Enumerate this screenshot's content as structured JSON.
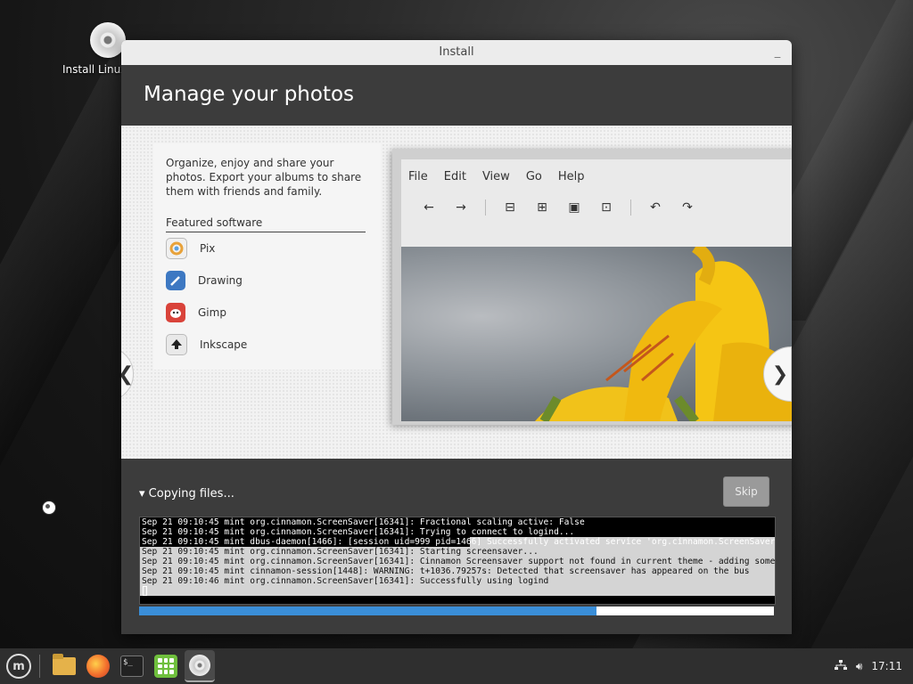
{
  "desktop": {
    "icon_label": "Install Linux"
  },
  "window": {
    "title": "Install",
    "minimize_glyph": "_",
    "heading": "Manage your photos",
    "description": "Organize, enjoy and share your photos. Export your albums to share them with friends and family.",
    "featured_title": "Featured software",
    "apps": [
      {
        "name": "Pix",
        "icon": "pix-icon",
        "color": "#f0f0f0"
      },
      {
        "name": "Drawing",
        "icon": "drawing-icon",
        "color": "#3d78c2"
      },
      {
        "name": "Gimp",
        "icon": "gimp-icon",
        "color": "#d9433a"
      },
      {
        "name": "Inkscape",
        "icon": "inkscape-icon",
        "color": "#e9e9e9"
      }
    ],
    "screenshot_menu": [
      "File",
      "Edit",
      "View",
      "Go",
      "Help"
    ],
    "prev_glyph": "❮",
    "next_glyph": "❯",
    "status": "▾ Copying files...",
    "skip_label": "Skip",
    "log_lines": [
      "Sep 21 09:10:45 mint org.cinnamon.ScreenSaver[16341]: Fractional scaling active: False",
      "Sep 21 09:10:45 mint org.cinnamon.ScreenSaver[16341]: Trying to connect to logind...",
      "Sep 21 09:10:45 mint dbus-daemon[1466]: [session uid=999 pid=1466] Successfully activated service 'org.cinnamon.ScreenSaver'",
      "Sep 21 09:10:45 mint org.cinnamon.ScreenSaver[16341]: Starting screensaver...",
      "Sep 21 09:10:45 mint org.cinnamon.ScreenSaver[16341]: Cinnamon Screensaver support not found in current theme - adding some...",
      "Sep 21 09:10:45 mint cinnamon-session[1448]: WARNING: t+1036.79257s: Detected that screensaver has appeared on the bus",
      "Sep 21 09:10:46 mint org.cinnamon.ScreenSaver[16341]: Successfully using logind"
    ],
    "progress_fraction": 0.72
  },
  "taskbar": {
    "clock": "17:11",
    "accent": "#3a8ed8"
  }
}
